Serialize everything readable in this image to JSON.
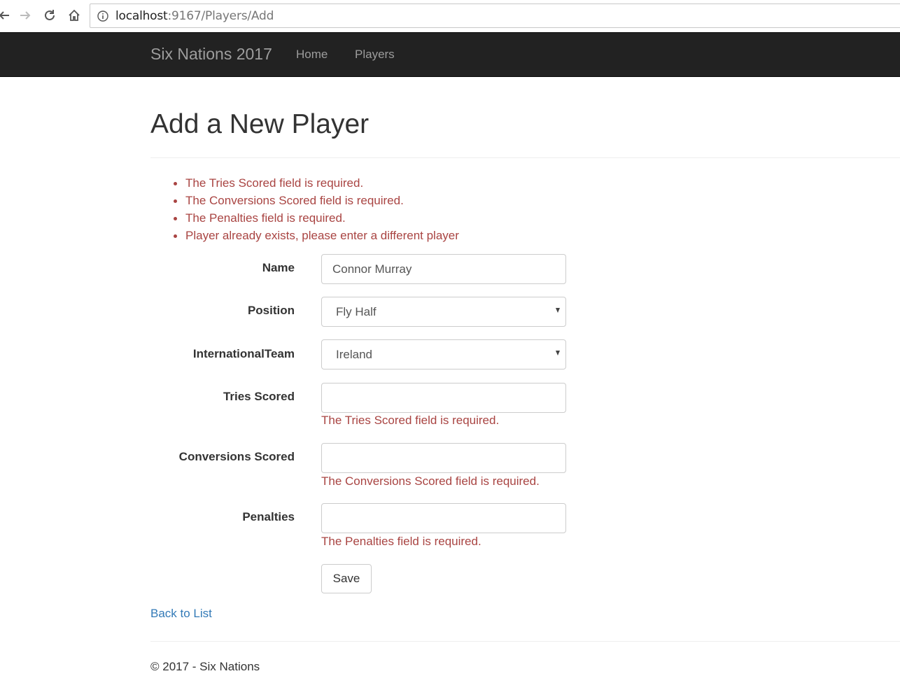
{
  "browser": {
    "url_host": "localhost",
    "url_rest": ":9167/Players/Add"
  },
  "navbar": {
    "brand": "Six Nations 2017",
    "links": [
      {
        "label": "Home"
      },
      {
        "label": "Players"
      }
    ]
  },
  "page": {
    "title": "Add a New Player"
  },
  "validation_summary": [
    "The Tries Scored field is required.",
    "The Conversions Scored field is required.",
    "The Penalties field is required.",
    "Player already exists, please enter a different player"
  ],
  "form": {
    "name": {
      "label": "Name",
      "value": "Connor Murray"
    },
    "position": {
      "label": "Position",
      "selected": "Fly Half"
    },
    "team": {
      "label": "InternationalTeam",
      "selected": "Ireland"
    },
    "tries": {
      "label": "Tries Scored",
      "value": "",
      "error": "The Tries Scored field is required."
    },
    "conversions": {
      "label": "Conversions Scored",
      "value": "",
      "error": "The Conversions Scored field is required."
    },
    "penalties": {
      "label": "Penalties",
      "value": "",
      "error": "The Penalties field is required."
    },
    "save_label": "Save"
  },
  "back_link": "Back to List",
  "footer": "© 2017 - Six Nations",
  "colors": {
    "navbar_bg": "#222222",
    "error": "#a94442",
    "link": "#337ab7"
  },
  "icons": [
    "back-arrow-icon",
    "forward-arrow-icon",
    "reload-icon",
    "home-icon",
    "info-icon",
    "chevron-down-icon"
  ]
}
